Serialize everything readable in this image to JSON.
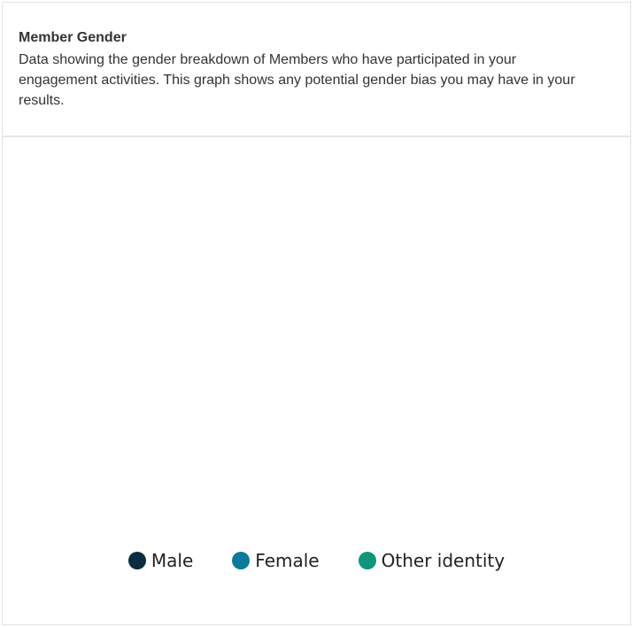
{
  "card": {
    "title": "Member Gender",
    "description": "Data showing the gender breakdown of Members who have participated in your engagement activities. This graph shows any potential gender bias you may have in your results."
  },
  "chart_data": {
    "type": "pie",
    "title": "",
    "categories": [
      "Male",
      "Female",
      "Other identity"
    ],
    "values": [],
    "colors": [
      "#0b2b40",
      "#0e7a9a",
      "#0f957b"
    ],
    "legend_position": "bottom-center"
  }
}
